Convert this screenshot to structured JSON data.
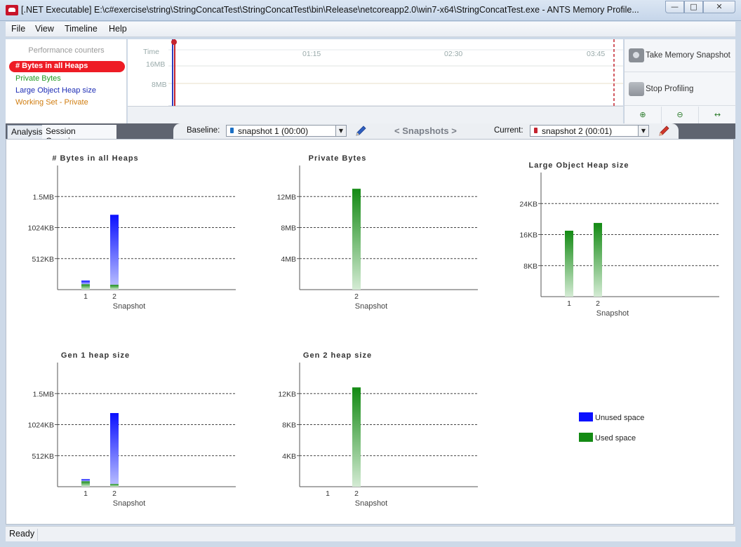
{
  "window": {
    "title": "[.NET Executable] E:\\c#exercise\\string\\StringConcatTest\\StringConcatTest\\bin\\Release\\netcoreapp2.0\\win7-x64\\StringConcatTest.exe - ANTS Memory Profile...",
    "minimize_glyph": "—",
    "maximize_glyph": "□",
    "close_glyph": "✕"
  },
  "menu": {
    "items": [
      {
        "label": "File"
      },
      {
        "label": "View"
      },
      {
        "label": "Timeline"
      },
      {
        "label": "Help"
      }
    ]
  },
  "counters": {
    "heading": "Performance counters",
    "items": [
      {
        "label": "# Bytes in all Heaps",
        "color": "#ee1c25",
        "selected": true
      },
      {
        "label": "Private Bytes",
        "color": "#1f9a1f"
      },
      {
        "label": "Large Object Heap size",
        "color": "#1d2db5"
      },
      {
        "label": "Working Set - Private",
        "color": "#d07d10"
      }
    ]
  },
  "timeline": {
    "time_label": "Time",
    "ticks": [
      "01:15",
      "02:30",
      "03:45"
    ],
    "y_labels": [
      "16MB",
      "8MB"
    ]
  },
  "snapshot_tools": {
    "take_snapshot": "Take Memory Snapshot",
    "stop_profiling": "Stop Profiling",
    "zoom_in": "⊕",
    "zoom_out": "⊖",
    "fit": "↔"
  },
  "tabs": [
    {
      "label": "Analysis",
      "active": true
    },
    {
      "label": "Session Overview",
      "active": false
    }
  ],
  "snapshot_bar": {
    "baseline_label": "Baseline:",
    "baseline_value": "snapshot 1 (00:00)",
    "center_label": "< Snapshots >",
    "current_label": "Current:",
    "current_value": "snapshot 2 (00:01)",
    "baseline_color": "#1b6fc4",
    "current_color": "#c4232f"
  },
  "colors": {
    "unused": "#0a10ff",
    "used": "#138a13"
  },
  "chart_data": [
    {
      "type": "bar",
      "title": "# Bytes in all Heaps",
      "xlabel": "Snapshot",
      "categories": [
        "1",
        "2"
      ],
      "yticks": [
        "1.5MB",
        "1024KB",
        "512KB"
      ],
      "ylim": [
        0,
        2048
      ],
      "series": [
        {
          "name": "Used space",
          "values": [
            90,
            80
          ]
        },
        {
          "name": "Unused space",
          "values": [
            60,
            1155
          ]
        }
      ]
    },
    {
      "type": "bar",
      "title": "Private Bytes",
      "xlabel": "Snapshot",
      "categories": [
        "2"
      ],
      "yticks": [
        "12MB",
        "8MB",
        "4MB"
      ],
      "ylim": [
        0,
        16
      ],
      "series": [
        {
          "name": "Used space",
          "values": [
            13
          ]
        }
      ]
    },
    {
      "type": "bar",
      "title": "Large Object Heap size",
      "xlabel": "Snapshot",
      "categories": [
        "1",
        "2"
      ],
      "yticks": [
        "24KB",
        "16KB",
        "8KB"
      ],
      "ylim": [
        0,
        32
      ],
      "series": [
        {
          "name": "Used space",
          "values": [
            17,
            19
          ]
        }
      ]
    },
    {
      "type": "bar",
      "title": "Gen 1 heap size",
      "xlabel": "Snapshot",
      "categories": [
        "1",
        "2"
      ],
      "yticks": [
        "1.5MB",
        "1024KB",
        "512KB"
      ],
      "ylim": [
        0,
        2048
      ],
      "series": [
        {
          "name": "Used space",
          "values": [
            90,
            45
          ]
        },
        {
          "name": "Unused space",
          "values": [
            35,
            1170
          ]
        }
      ]
    },
    {
      "type": "bar",
      "title": "Gen 2 heap size",
      "xlabel": "Snapshot",
      "categories": [
        "1",
        "2"
      ],
      "yticks": [
        "12KB",
        "8KB",
        "4KB"
      ],
      "ylim": [
        0,
        16
      ],
      "series": [
        {
          "name": "Used space",
          "values": [
            0,
            12.8
          ]
        }
      ]
    }
  ],
  "legend": {
    "items": [
      {
        "label": "Unused space",
        "color": "#0a10ff"
      },
      {
        "label": "Used space",
        "color": "#138a13"
      }
    ]
  },
  "status": {
    "text": "Ready"
  }
}
